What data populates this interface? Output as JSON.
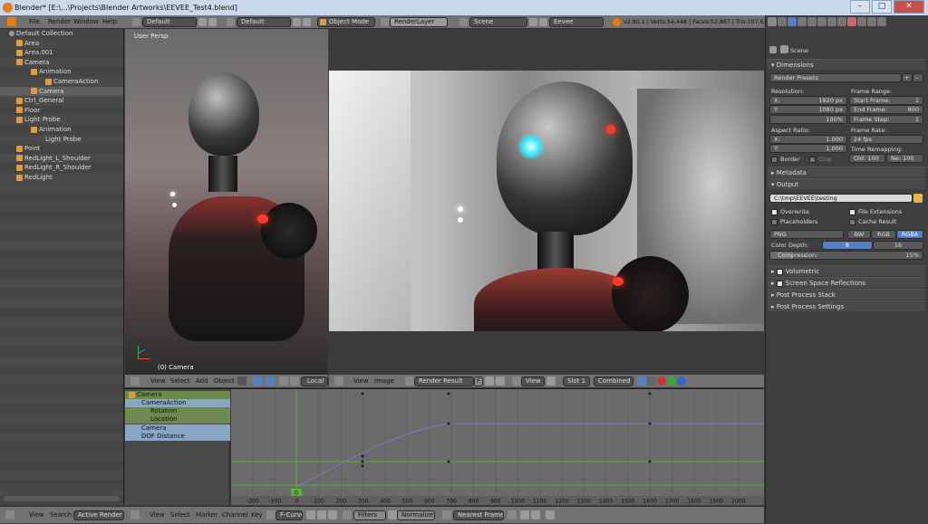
{
  "window": {
    "title": "Blender* [E:\\...\\Projects\\Blender Artworks\\EEVEE_Test4.blend]"
  },
  "topbar": {
    "menus": [
      "File",
      "Render",
      "Window",
      "Help"
    ],
    "layout": "Default",
    "scene_layout": "Default",
    "mode": "Object Mode",
    "render_layer": "RenderLayer",
    "scene": "Scene",
    "engine": "Eevee",
    "stats": "v2.80.1 | Verts:54,448 | Faces:52,867 | Tris:107,614 | Objects:1/74 | Lamps:1/6 | Mem:169.03M | Camera"
  },
  "outliner": {
    "items": [
      {
        "label": "Default Collection",
        "indent": 0
      },
      {
        "label": "Area",
        "indent": 1
      },
      {
        "label": "Area.001",
        "indent": 1
      },
      {
        "label": "Camera",
        "indent": 1
      },
      {
        "label": "Animation",
        "indent": 2
      },
      {
        "label": "CameraAction",
        "indent": 3
      },
      {
        "label": "Camera",
        "indent": 2
      },
      {
        "label": "Ctrl_General",
        "indent": 1
      },
      {
        "label": "Floor",
        "indent": 1
      },
      {
        "label": "Light Probe",
        "indent": 1
      },
      {
        "label": "Animation",
        "indent": 2
      },
      {
        "label": "Light Probe",
        "indent": 2
      },
      {
        "label": "Point",
        "indent": 1
      },
      {
        "label": "RedLight_L_Shoulder",
        "indent": 1
      },
      {
        "label": "RedLight_R_Shoulder",
        "indent": 1
      },
      {
        "label": "RedLight",
        "indent": 1
      }
    ],
    "footer": {
      "view": "View",
      "search": "Search",
      "filter": "Active Render Laye"
    }
  },
  "viewport": {
    "label": "User Persp",
    "object_label": "(0) Camera",
    "menus": [
      "View",
      "Select",
      "Add",
      "Object"
    ],
    "pivot": "Local"
  },
  "image_editor": {
    "menus": [
      "View",
      "Image"
    ],
    "image": "Render Result",
    "f_label": "F",
    "view": "View",
    "slot": "Slot 1",
    "pass": "Combined"
  },
  "properties": {
    "breadcrumb": "Scene",
    "dimensions": {
      "title": "Dimensions",
      "presets": "Render Presets",
      "resolution_label": "Resolution:",
      "res_x_label": "X:",
      "res_x": "1920 px",
      "res_y_label": "Y:",
      "res_y": "1080 px",
      "res_pct": "100%",
      "frame_range_label": "Frame Range:",
      "start_label": "Start Frame:",
      "start": "1",
      "end_label": "End Frame:",
      "end": "800",
      "step_label": "Frame Step:",
      "step": "1",
      "aspect_label": "Aspect Ratio:",
      "asp_x_label": "X:",
      "asp_x": "1.000",
      "asp_y_label": "Y:",
      "asp_y": "1.000",
      "frame_rate_label": "Frame Rate:",
      "fps": "24 fps",
      "time_remap_label": "Time Remapping:",
      "old_label": "Old:",
      "old": "100",
      "new_label": "Ne:",
      "new": "100",
      "border": "Border",
      "crop": "Crop"
    },
    "metadata_title": "Metadata",
    "output": {
      "title": "Output",
      "path": "C:\\tmp\\EEVEE\\testing",
      "overwrite": "Overwrite",
      "file_extensions": "File Extensions",
      "placeholders": "Placeholders",
      "cache_result": "Cache Result",
      "format": "PNG",
      "bw": "BW",
      "rgb": "RGB",
      "rgba": "RGBA",
      "color_depth_label": "Color Depth:",
      "depth_8": "8",
      "depth_16": "16",
      "compression_label": "Compression:",
      "compression": "15%",
      "compression_value": 0.15
    },
    "sections": [
      "Volumetric",
      "Screen Space Reflections",
      "Post Process Stack",
      "Post Process Settings"
    ]
  },
  "graph_editor": {
    "channels": [
      {
        "label": "Camera",
        "level": 0
      },
      {
        "label": "CameraAction",
        "level": 1
      },
      {
        "label": "Rotation",
        "level": 2
      },
      {
        "label": "Location",
        "level": 2
      },
      {
        "label": "Camera",
        "level": 0
      },
      {
        "label": "DOF Distance",
        "level": 1
      }
    ],
    "ticks": [
      "-200",
      "-100",
      "0",
      "100",
      "200",
      "300",
      "400",
      "500",
      "600",
      "700",
      "800",
      "900",
      "1000",
      "1100",
      "1200",
      "1300",
      "1400",
      "1500",
      "1600",
      "1700",
      "1800",
      "1900",
      "2000"
    ],
    "current_frame": "0",
    "footer": {
      "menus": [
        "View",
        "Select",
        "Marker",
        "Channel",
        "Key"
      ],
      "mode": "F-Curve",
      "filters": "Filters",
      "normalize": "Normalize",
      "interp": "Nearest Frame"
    }
  },
  "colors": {
    "accent": "#5680c2",
    "blender_orange": "#e87d0d",
    "keyframe_green": "#5bb13a",
    "selected_row": "#6d8a4d"
  }
}
